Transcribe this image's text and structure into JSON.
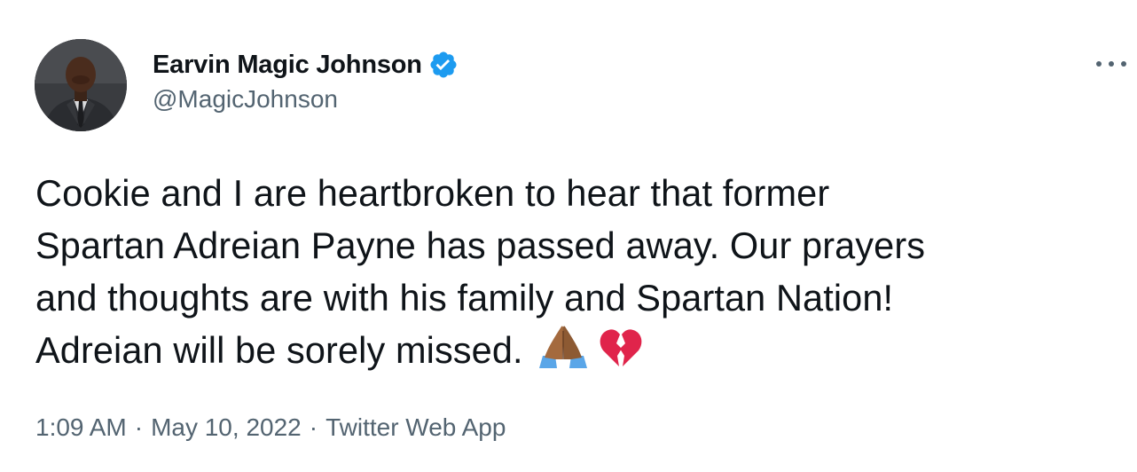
{
  "author": {
    "display_name": "Earvin Magic Johnson",
    "handle": "@MagicJohnson",
    "verified": true,
    "avatar_icon": "profile-photo",
    "verified_icon": "verified-badge-icon"
  },
  "menu": {
    "icon": "more-options-icon"
  },
  "tweet": {
    "lines": [
      "Cookie and I are heartbroken to hear that former",
      "Spartan Adreian Payne has passed away. Our prayers",
      "and thoughts are with his family and Spartan Nation!",
      "Adreian will be sorely missed."
    ],
    "emojis": [
      "folded-hands-emoji",
      "broken-heart-emoji"
    ]
  },
  "meta": {
    "time": "1:09 AM",
    "separator": "·",
    "date": "May 10, 2022",
    "source": "Twitter Web App"
  },
  "colors": {
    "text_primary": "#0f1419",
    "text_secondary": "#536471",
    "verified_blue": "#1d9bf0",
    "background": "#ffffff"
  }
}
